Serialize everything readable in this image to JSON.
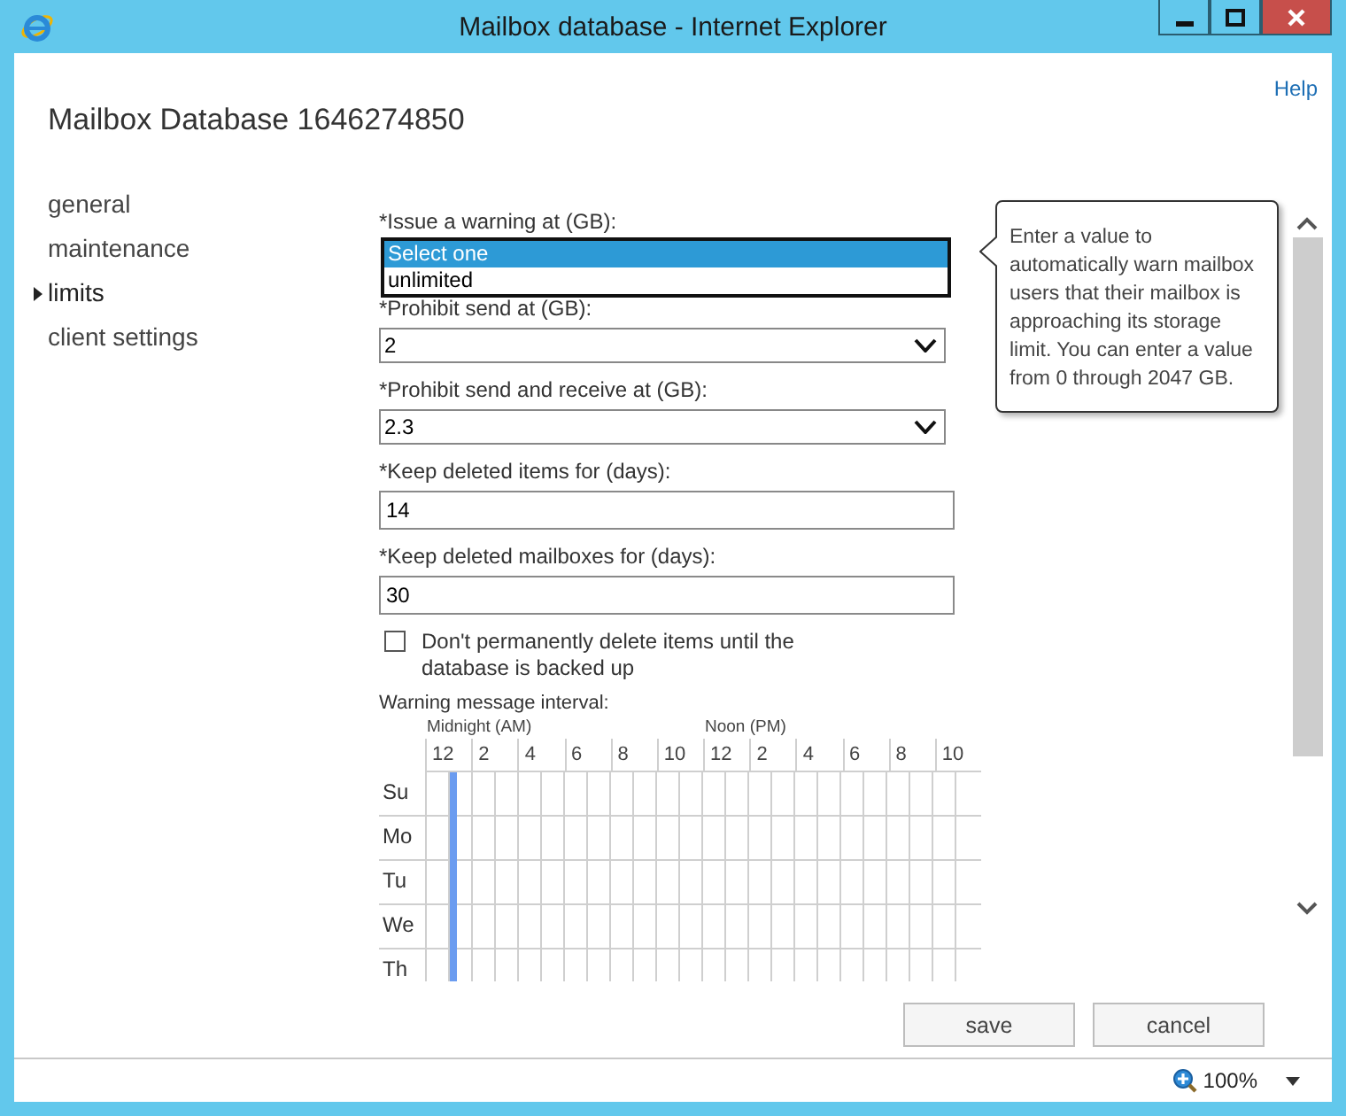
{
  "window": {
    "title": "Mailbox database - Internet Explorer"
  },
  "page": {
    "help_link": "Help",
    "title": "Mailbox Database 1646274850"
  },
  "nav": [
    {
      "label": "general",
      "selected": false
    },
    {
      "label": "maintenance",
      "selected": false
    },
    {
      "label": "limits",
      "selected": true
    },
    {
      "label": "client settings",
      "selected": false
    }
  ],
  "form": {
    "fields": [
      {
        "kind": "open-dropdown",
        "label": "*Issue a warning at (GB):",
        "options": [
          {
            "label": "Select one",
            "selected": true
          },
          {
            "label": "unlimited",
            "selected": false
          }
        ]
      },
      {
        "kind": "dropdown",
        "label": "*Prohibit send at (GB):",
        "value": "2"
      },
      {
        "kind": "dropdown",
        "label": "*Prohibit send and receive at (GB):",
        "value": "2.3"
      },
      {
        "kind": "text",
        "label": "*Keep deleted items for (days):",
        "value": "14"
      },
      {
        "kind": "text",
        "label": "*Keep deleted mailboxes for (days):",
        "value": "30"
      },
      {
        "kind": "checkbox",
        "label": "Don't permanently delete items until the database is backed up",
        "checked": false
      }
    ]
  },
  "schedule": {
    "label": "Warning message interval:",
    "period_labels": [
      "Midnight (AM)",
      "Noon (PM)"
    ],
    "hours": [
      "12",
      "2",
      "4",
      "6",
      "8",
      "10",
      "12",
      "2",
      "4",
      "6",
      "8",
      "10"
    ],
    "days": [
      {
        "label": "Su",
        "marked": true
      },
      {
        "label": "Mo",
        "marked": true
      },
      {
        "label": "Tu",
        "marked": true
      },
      {
        "label": "We",
        "marked": true
      },
      {
        "label": "Th",
        "marked": true
      }
    ]
  },
  "tooltip": {
    "text": "Enter a value to automatically warn mailbox users that their mailbox is approaching its storage limit. You can enter a value from 0 through 2047 GB."
  },
  "buttons": [
    {
      "label": "save"
    },
    {
      "label": "cancel"
    }
  ],
  "status_bar": {
    "zoom": "100%"
  }
}
